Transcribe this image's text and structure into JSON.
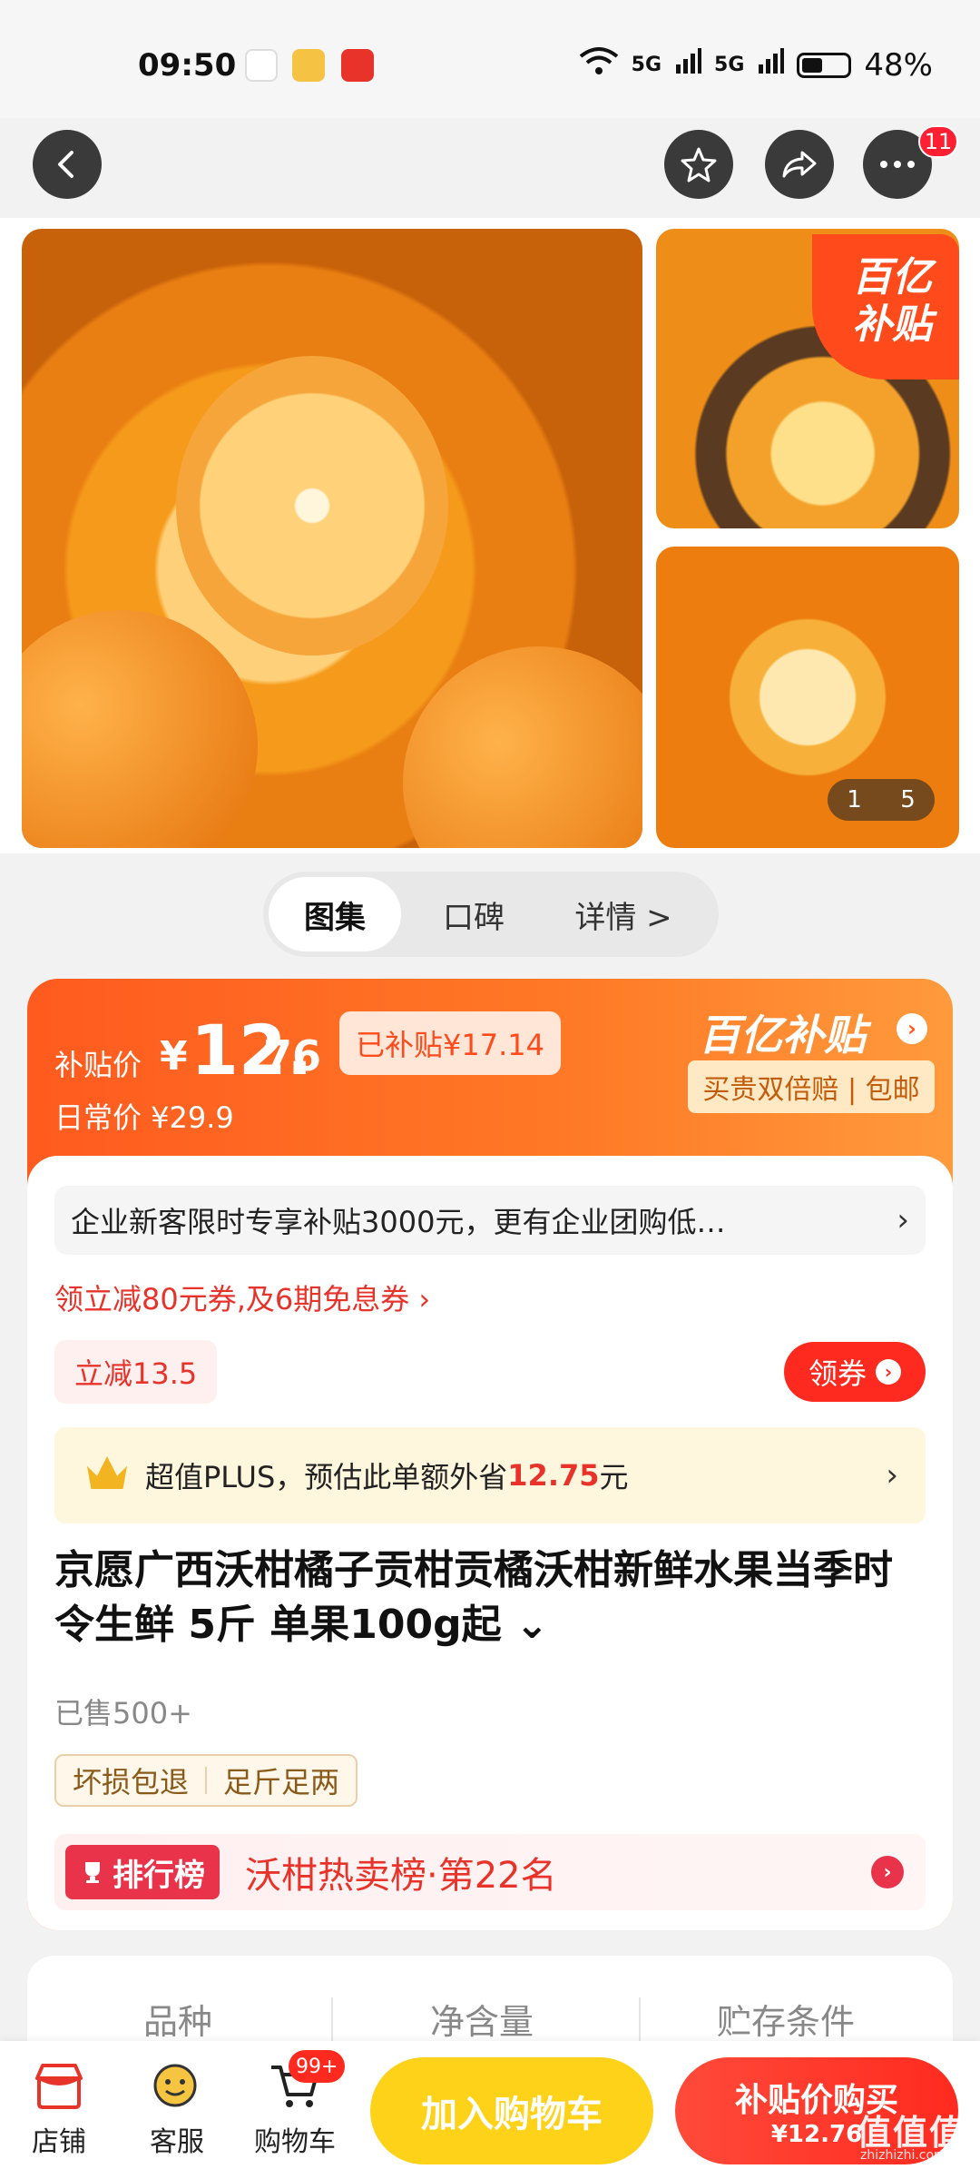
{
  "status_bar": {
    "time": "09:50",
    "battery": "48%",
    "signal_1": "5G",
    "signal_2": "5G"
  },
  "nav": {
    "notification_count": "11"
  },
  "gallery": {
    "subsidy_corner_line1": "百亿",
    "subsidy_corner_line2": "补贴",
    "pager_current": "1",
    "pager_total": "5"
  },
  "tabs": [
    {
      "label": "图集"
    },
    {
      "label": "口碑"
    },
    {
      "label": "详情 >"
    }
  ],
  "price": {
    "label": "补贴价",
    "yen": "¥",
    "integer": "12.",
    "decimal": "76",
    "subsidized": "已补贴¥17.14",
    "daily": "日常价 ¥29.9",
    "brand": "百亿补贴",
    "brand_arrow": "›",
    "guarantee": "买贵双倍赔 | 包邮"
  },
  "enterprise": {
    "text": "企业新客限时专享补贴3000元，更有企业团购低…",
    "chevron": "›"
  },
  "coupon": {
    "text": "领立减80元券,及6期免息券 ›"
  },
  "instant_discount": {
    "label": "立减13.5"
  },
  "get_coupon": {
    "label": "领券"
  },
  "plus": {
    "prefix": "超值PLUS，预估此单额外省",
    "amount": "12.75",
    "suffix": "元",
    "chevron": "›"
  },
  "product": {
    "title": "京愿广西沃柑橘子贡柑贡橘沃柑新鲜水果当季时令生鲜 5斤 单果100g起 ⌄",
    "sold": "已售500+"
  },
  "tags": [
    "坏损包退",
    "足斤足两"
  ],
  "ranking": {
    "badge": "排行榜",
    "text": "沃柑热卖榜·第22名"
  },
  "specs": [
    "品种",
    "净含量",
    "贮存条件"
  ],
  "bottom_bar": {
    "store": "店铺",
    "service": "客服",
    "cart": "购物车",
    "cart_badge": "99+",
    "add_to_cart": "加入购物车",
    "buy_line1": "补贴价购买",
    "buy_line2": "¥12.76"
  },
  "watermark": {
    "text": "值值值",
    "sub": "zhizhizhi.com"
  },
  "colors": {
    "accent": "#ff5a1f",
    "red": "#e8332b",
    "yellow": "#ffd21a"
  }
}
